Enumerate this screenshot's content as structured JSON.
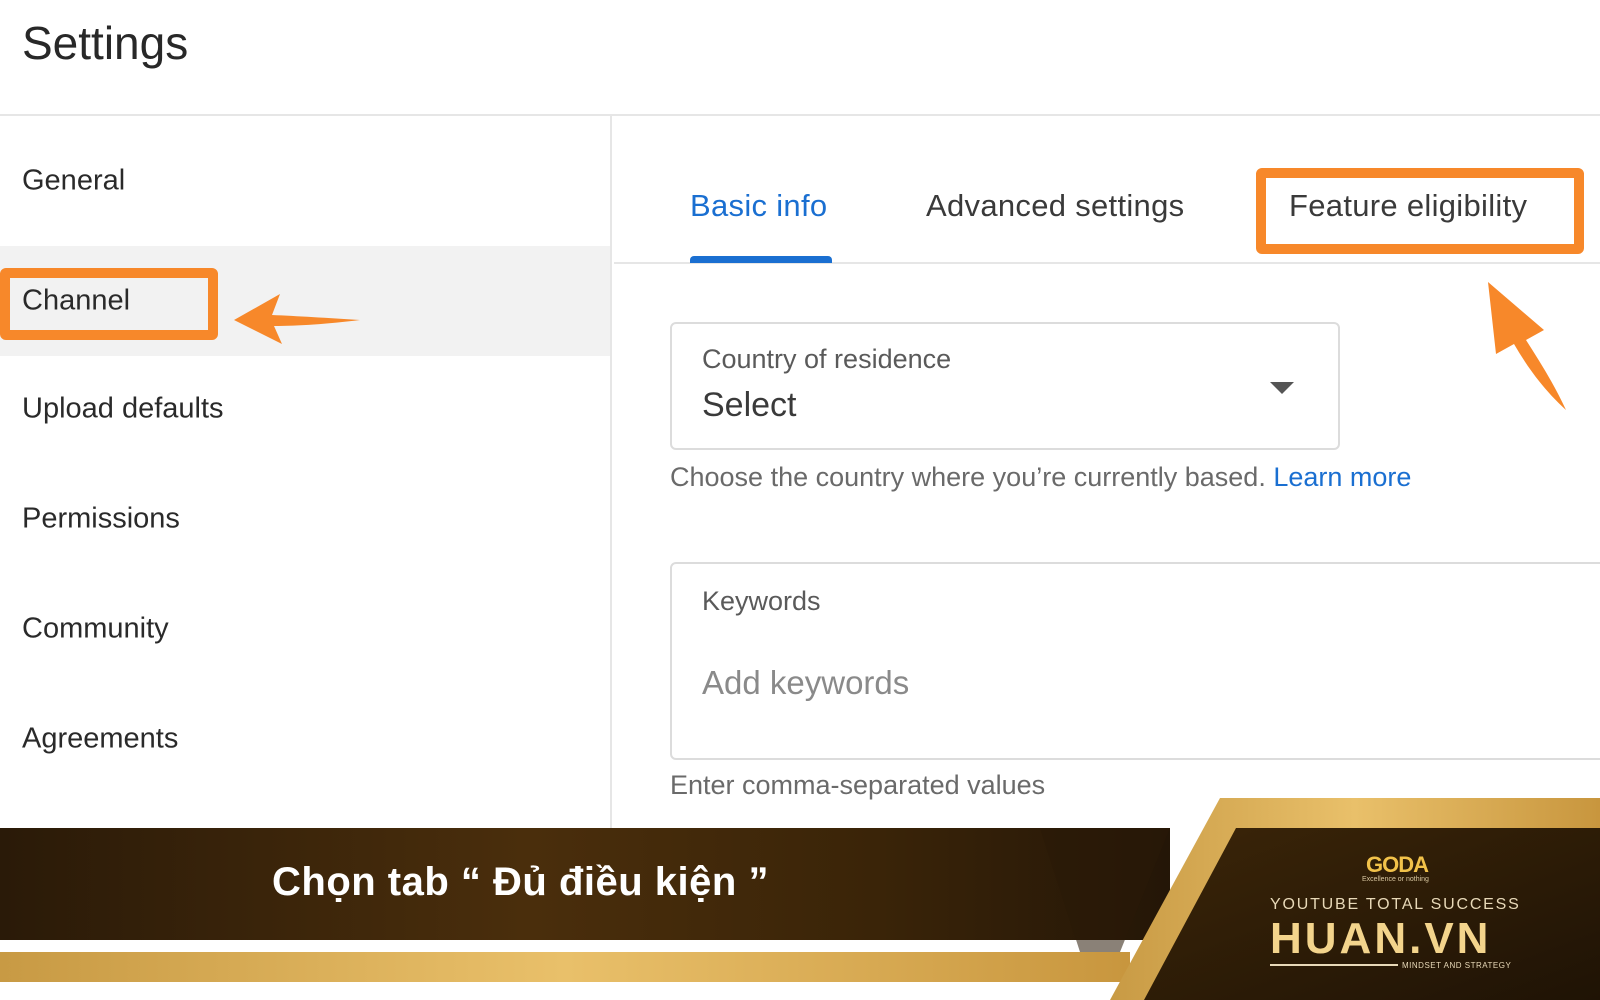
{
  "header": {
    "title": "Settings"
  },
  "sidebar": {
    "items": [
      {
        "label": "General"
      },
      {
        "label": "Channel"
      },
      {
        "label": "Upload defaults"
      },
      {
        "label": "Permissions"
      },
      {
        "label": "Community"
      },
      {
        "label": "Agreements"
      }
    ],
    "active_index": 1
  },
  "tabs": [
    {
      "label": "Basic info"
    },
    {
      "label": "Advanced settings"
    },
    {
      "label": "Feature eligibility"
    }
  ],
  "active_tab": 0,
  "country_field": {
    "label": "Country of residence",
    "value": "Select",
    "helper": "Choose the country where you’re currently based.",
    "link": "Learn more"
  },
  "keywords_field": {
    "label": "Keywords",
    "placeholder": "Add keywords",
    "helper": "Enter comma-separated values"
  },
  "banner": {
    "instruction": "Chọn tab “ Đủ điều kiện ”"
  },
  "brand": {
    "logo": "GODA",
    "logo_tagline": "Excellence or nothing",
    "line1": "YOUTUBE TOTAL SUCCESS",
    "name": "HUAN.VN",
    "tagline": "MINDSET AND STRATEGY"
  },
  "colors": {
    "accent_blue": "#1a6fd1",
    "highlight_orange": "#f7882a",
    "banner_brown": "#4a2e0c",
    "gold": "#e9c06a"
  },
  "icons": {
    "dropdown": "triangle-down-icon",
    "pointer": "orange-arrow-icon"
  }
}
